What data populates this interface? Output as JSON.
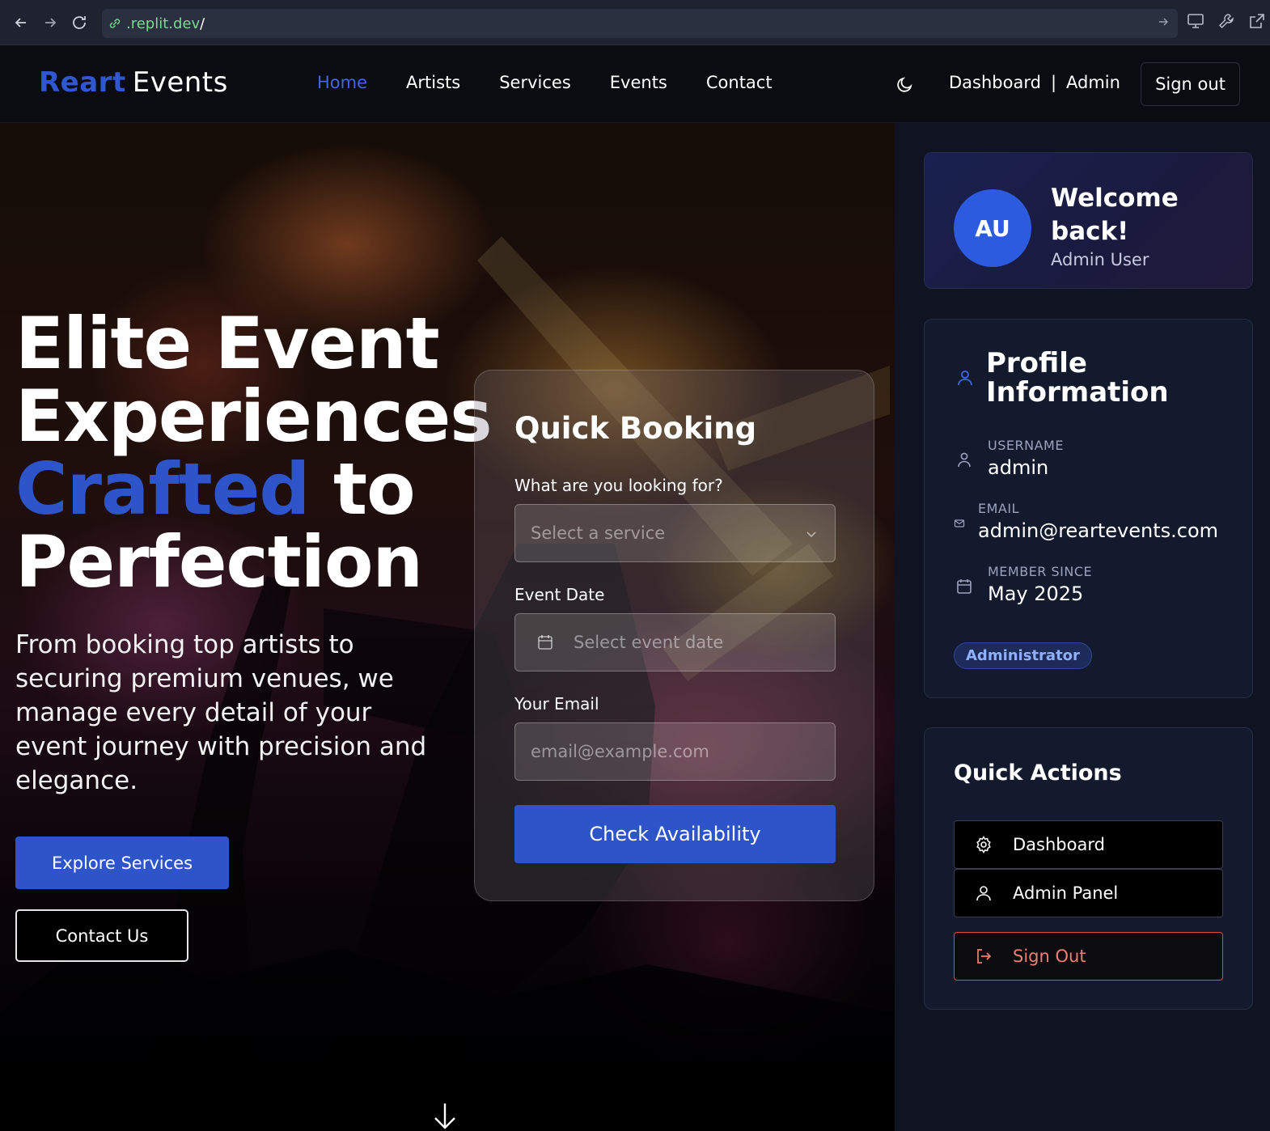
{
  "browser": {
    "url_domain": ".replit.dev",
    "url_path": "/"
  },
  "nav": {
    "logo_brand": "Reart",
    "logo_suffix": "Events",
    "links": [
      "Home",
      "Artists",
      "Services",
      "Events",
      "Contact"
    ],
    "active_link": "Home",
    "dashboard_label": "Dashboard",
    "separator": "|",
    "admin_label": "Admin",
    "signout_label": "Sign out"
  },
  "hero": {
    "title_line1": "Elite Event",
    "title_line2": "Experiences",
    "title_accent": "Crafted",
    "title_line3_rest": "to",
    "title_line4": "Perfection",
    "subtitle": "From booking top artists to securing premium venues, we manage every detail of your event journey with precision and elegance.",
    "explore_button": "Explore Services",
    "contact_button": "Contact Us"
  },
  "booking": {
    "title": "Quick Booking",
    "service_label": "What are you looking for?",
    "service_placeholder": "Select a service",
    "date_label": "Event Date",
    "date_placeholder": "Select event date",
    "email_label": "Your Email",
    "email_placeholder": "email@example.com",
    "submit": "Check Availability"
  },
  "welcome": {
    "initials": "AU",
    "title": "Welcome back!",
    "name": "Admin User"
  },
  "profile": {
    "title": "Profile Information",
    "username_label": "USERNAME",
    "username": "admin",
    "email_label": "EMAIL",
    "email": "admin@reartevents.com",
    "member_label": "MEMBER SINCE",
    "member_since": "May 2025",
    "role_badge": "Administrator"
  },
  "quick_actions": {
    "title": "Quick Actions",
    "dashboard": "Dashboard",
    "admin_panel": "Admin Panel",
    "sign_out": "Sign Out"
  },
  "colors": {
    "accent": "#2d55c9",
    "danger": "#d94a3b",
    "panel_bg": "#0f1322"
  }
}
